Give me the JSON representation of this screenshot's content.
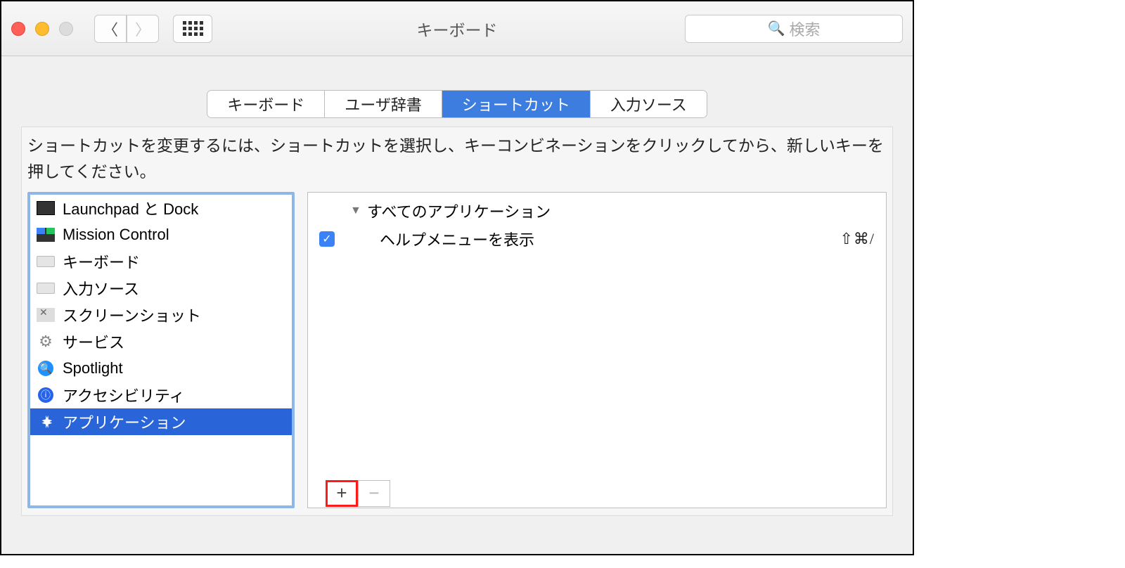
{
  "window": {
    "title": "キーボード"
  },
  "search": {
    "placeholder": "検索"
  },
  "tabs": [
    {
      "label": "キーボード"
    },
    {
      "label": "ユーザ辞書"
    },
    {
      "label": "ショートカット",
      "active": true
    },
    {
      "label": "入力ソース"
    }
  ],
  "instructions": "ショートカットを変更するには、ショートカットを選択し、キーコンビネーションをクリックしてから、新しいキーを押してください。",
  "sidebar": [
    {
      "label": "Launchpad と Dock"
    },
    {
      "label": "Mission Control"
    },
    {
      "label": "キーボード"
    },
    {
      "label": "入力ソース"
    },
    {
      "label": "スクリーンショット"
    },
    {
      "label": "サービス"
    },
    {
      "label": "Spotlight"
    },
    {
      "label": "アクセシビリティ"
    },
    {
      "label": "アプリケーション",
      "selected": true
    }
  ],
  "detail": {
    "group": "すべてのアプリケーション",
    "items": [
      {
        "label": "ヘルプメニューを表示",
        "shortcut": "⇧⌘/",
        "checked": true
      }
    ]
  },
  "buttons": {
    "plus": "+",
    "minus": "−"
  }
}
